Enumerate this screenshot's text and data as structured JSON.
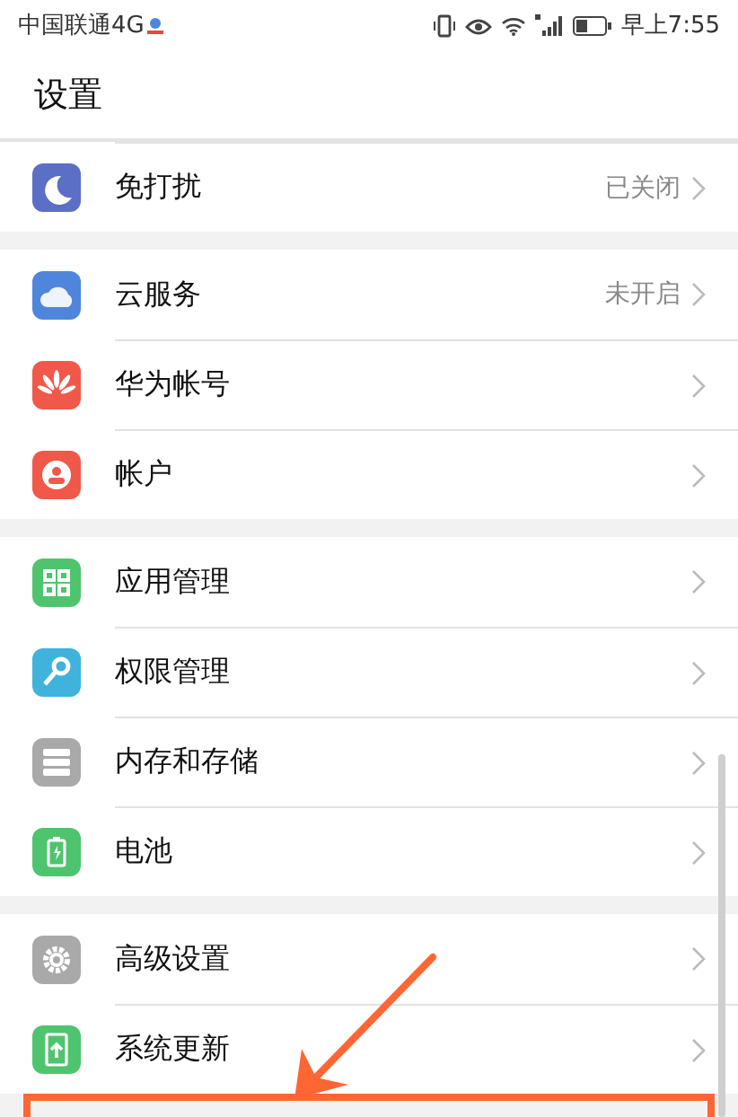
{
  "status_bar": {
    "carrier": "中国联通4G",
    "time": "早上7:55"
  },
  "title": "设置",
  "sections": [
    {
      "items": [
        {
          "kind": "moon",
          "label": "免打扰",
          "value": "已关闭"
        }
      ]
    },
    {
      "items": [
        {
          "kind": "cloud",
          "label": "云服务",
          "value": "未开启"
        },
        {
          "kind": "flower",
          "label": "华为帐号"
        },
        {
          "kind": "person",
          "label": "帐户"
        }
      ]
    },
    {
      "items": [
        {
          "kind": "apps",
          "label": "应用管理"
        },
        {
          "kind": "key",
          "label": "权限管理"
        },
        {
          "kind": "storage",
          "label": "内存和存储"
        },
        {
          "kind": "battery",
          "label": "电池"
        }
      ]
    },
    {
      "items": [
        {
          "kind": "gear",
          "label": "高级设置"
        },
        {
          "kind": "update",
          "label": "系统更新"
        }
      ]
    }
  ]
}
